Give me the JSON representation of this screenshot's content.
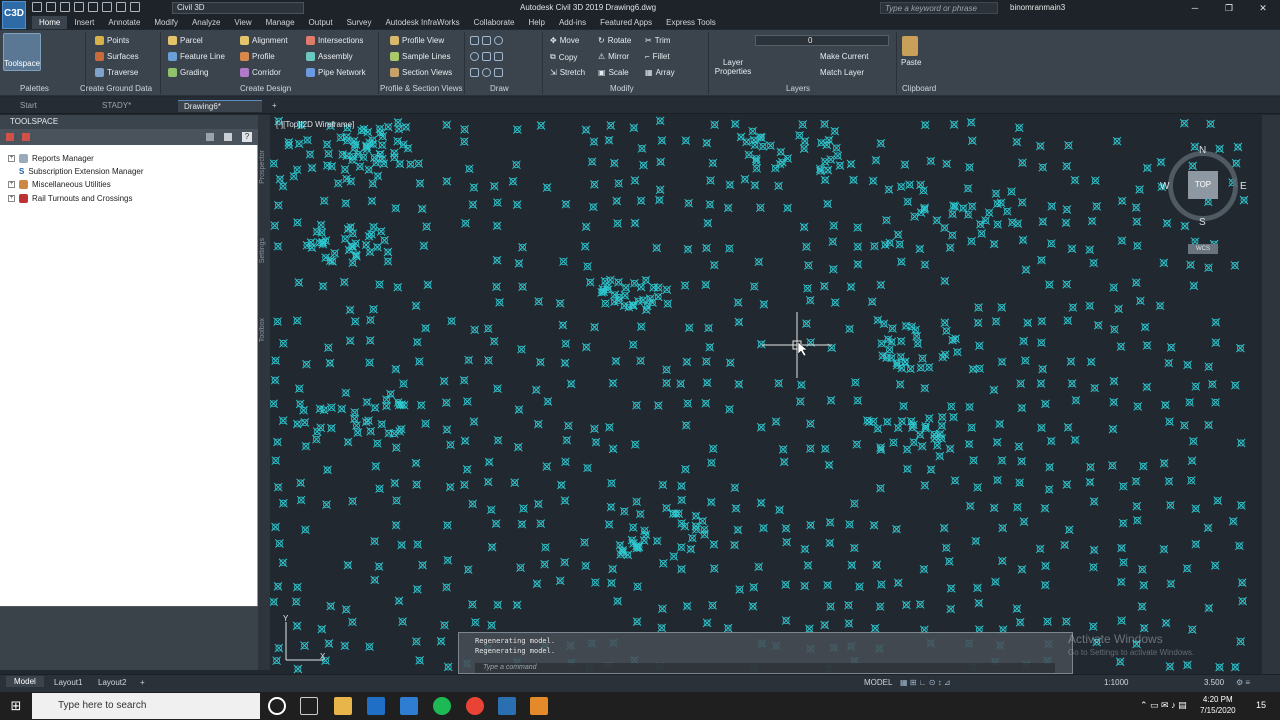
{
  "titlebar": {
    "app_icon": "C3D",
    "workspace": "Civil 3D",
    "window_title": "Autodesk Civil 3D 2019    Drawing6.dwg",
    "search_placeholder": "Type a keyword or phrase",
    "user": "binomranmain3"
  },
  "tabs": [
    "Home",
    "Insert",
    "Annotate",
    "Modify",
    "Analyze",
    "View",
    "Manage",
    "Output",
    "Survey",
    "Autodesk InfraWorks",
    "Collaborate",
    "Help",
    "Add-ins",
    "Featured Apps",
    "Express Tools"
  ],
  "ribbon": {
    "toolspace": "Toolspace",
    "ground": [
      "Points",
      "Surfaces",
      "Traverse"
    ],
    "design1": [
      "Parcel",
      "Feature Line",
      "Grading"
    ],
    "design2": [
      "Alignment",
      "Profile",
      "Corridor"
    ],
    "design3": [
      "Intersections",
      "Assembly",
      "Pipe Network"
    ],
    "profile": [
      "Profile View",
      "Sample Lines",
      "Section Views"
    ],
    "modify1": [
      "Move",
      "Copy",
      "Stretch"
    ],
    "modify2": [
      "Rotate",
      "Mirror",
      "Scale"
    ],
    "modify3": [
      "Trim",
      "Fillet",
      "Array"
    ],
    "layer_props": "Layer Properties",
    "layer_value": "0",
    "layers": [
      "Make Current",
      "Match Layer"
    ],
    "paste": "Paste",
    "panels": [
      "Palettes",
      "Create Ground Data",
      "Create Design",
      "Profile & Section Views",
      "Draw",
      "Modify",
      "Layers",
      "Clipboard"
    ]
  },
  "filetabs": [
    "Start",
    "STADY*",
    "Drawing6*"
  ],
  "toolspace": {
    "title": "TOOLSPACE",
    "items": [
      "Reports Manager",
      "Subscription Extension Manager",
      "Miscellaneous Utilities",
      "Rail Turnouts and Crossings"
    ],
    "side_tabs": [
      "Prospector",
      "Settings",
      "Toolbox"
    ]
  },
  "viewport": {
    "label": "[-][Top][2D Wireframe]",
    "compass": {
      "n": "N",
      "s": "S",
      "e": "E",
      "w": "W",
      "top": "TOP",
      "wcs": "WCS"
    }
  },
  "command": {
    "history": [
      "Regenerating model.",
      "Regenerating model."
    ],
    "placeholder": "Type a command"
  },
  "watermark": {
    "title": "Activate Windows",
    "sub": "Go to Settings to activate Windows."
  },
  "layouts": [
    "Model",
    "Layout1",
    "Layout2"
  ],
  "status": {
    "model": "MODEL",
    "scale": "1:1000",
    "value": "3.500"
  },
  "taskbar": {
    "search": "Type here to search",
    "time": "4:20 PM",
    "date": "7/15/2020",
    "notif": "15"
  },
  "colors": {
    "points": "#2ec8d0",
    "viewport": "#222830",
    "ribbon": "#3b444d"
  }
}
